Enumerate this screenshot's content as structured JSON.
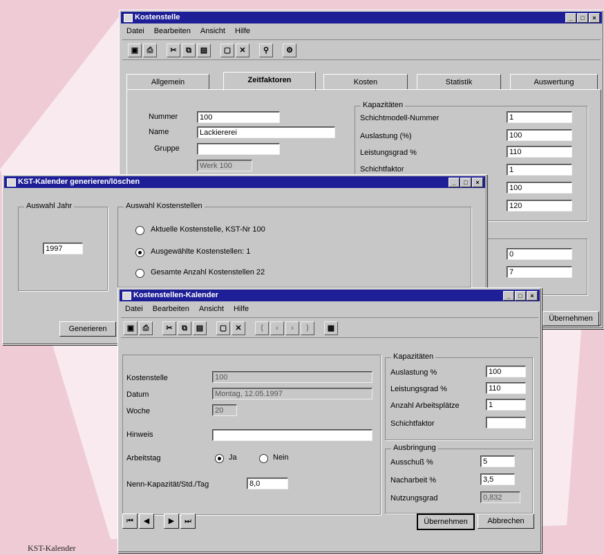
{
  "caption": "KST-Kalender",
  "colors": {
    "background": "#efcbd6",
    "titlebar": "#1e1e96",
    "window": "#c7c7c7"
  },
  "win1": {
    "title": "Kostenstelle",
    "menu": [
      "Datei",
      "Bearbeiten",
      "Ansicht",
      "Hilfe"
    ],
    "tabs": [
      "Allgemein",
      "Zeitfaktoren",
      "Kosten",
      "Statistik",
      "Auswertung"
    ],
    "left": {
      "labels": [
        "Nummer",
        "Name",
        "Gruppe"
      ],
      "values": [
        "100",
        "Lackiererei",
        "",
        "Werk 100"
      ]
    },
    "kap_group_title": "Kapazitäten",
    "kap_labels": [
      "Schichtmodell-Nummer",
      "Auslastung (%)",
      "Leistungsgrad %",
      "Schichtfaktor"
    ],
    "kap_values": [
      "1",
      "100",
      "110",
      "1",
      "100",
      "120"
    ],
    "lower_values": [
      "0",
      "7"
    ],
    "button_label": "Übernehmen"
  },
  "win2": {
    "title": "KST-Kalender generieren/löschen",
    "group1_title": "Auswahl Jahr",
    "year_value": "1997",
    "group2_title": "Auswahl Kostenstellen",
    "radios": [
      "Aktuelle Kostenstelle, KST-Nr 100",
      "Ausgewählte Kostenstellen: 1",
      "Gesamte Anzahl Kostenstellen 22"
    ],
    "button_label": "Generieren"
  },
  "win3": {
    "title": "Kostenstellen-Kalender",
    "menu": [
      "Datei",
      "Bearbeiten",
      "Ansicht",
      "Hilfe"
    ],
    "labels": [
      "Kostenstelle",
      "Datum",
      "Woche",
      "Hinweis",
      "Arbeitstag",
      "Nenn-Kapazität/Std./Tag"
    ],
    "values": [
      "100",
      "Montag, 12.05.1997",
      "20",
      "",
      "8,0"
    ],
    "radio_yes": "Ja",
    "radio_no": "Nein",
    "kap_group_title": "Kapazitäten",
    "kap_labels": [
      "Auslastung %",
      "Leistungsgrad %",
      "Anzahl Arbeitsplätze",
      "Schichtfaktor"
    ],
    "kap_values": [
      "100",
      "110",
      "1",
      ""
    ],
    "ausb_group_title": "Ausbringung",
    "ausb_labels": [
      "Ausschuß %",
      "Nacharbeit %",
      "Nutzungsgrad"
    ],
    "ausb_values": [
      "5",
      "3,5",
      "0,832"
    ],
    "btn_apply": "Übernehmen",
    "btn_cancel": "Abbrechen"
  }
}
